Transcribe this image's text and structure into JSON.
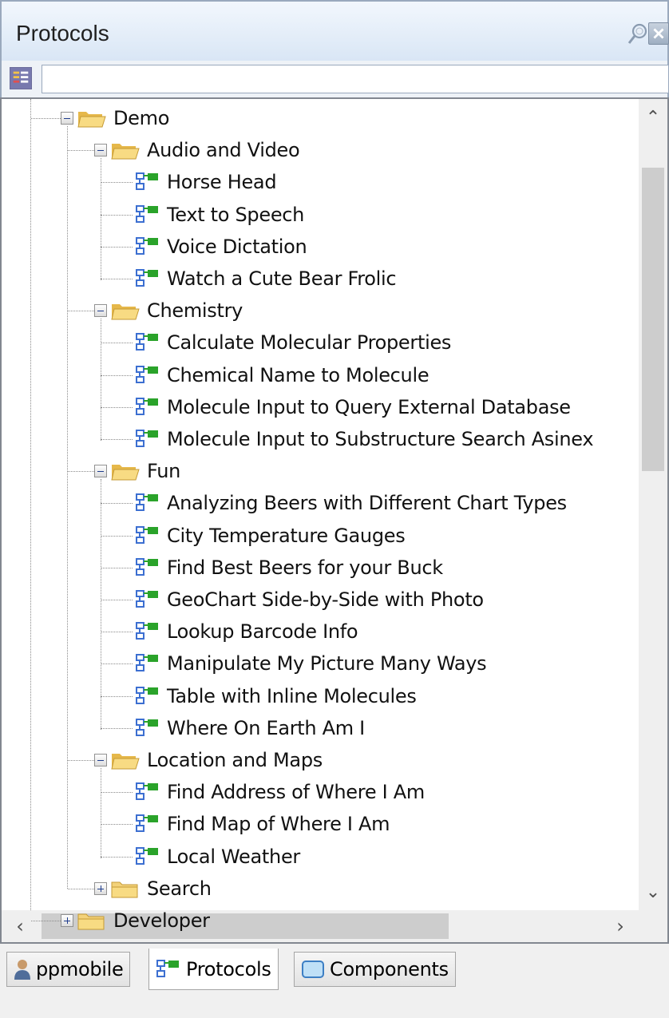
{
  "window": {
    "title": "Protocols",
    "pin_icon": "pushpin-icon",
    "close_icon": "close-icon"
  },
  "filter": {
    "icon": "filter-options-icon",
    "value": "",
    "placeholder": ""
  },
  "tree": {
    "root_open": {
      "label": "Demo",
      "icon": "folder-open-icon"
    },
    "groups": [
      {
        "label": "Audio and Video",
        "icon": "folder-open-icon",
        "items": [
          "Horse Head",
          "Text to Speech",
          "Voice Dictation",
          "Watch a Cute Bear Frolic"
        ]
      },
      {
        "label": "Chemistry",
        "icon": "folder-open-icon",
        "items": [
          "Calculate Molecular Properties",
          "Chemical Name to Molecule",
          "Molecule Input to Query External Database",
          "Molecule Input to Substructure Search Asinex"
        ]
      },
      {
        "label": "Fun",
        "icon": "folder-open-icon",
        "items": [
          "Analyzing Beers with Different Chart Types",
          "City Temperature Gauges",
          "Find Best Beers for your Buck",
          "GeoChart Side-by-Side with Photo",
          "Lookup Barcode Info",
          "Manipulate My Picture Many Ways",
          "Table with Inline Molecules",
          "Where On Earth Am I"
        ]
      },
      {
        "label": "Location and Maps",
        "icon": "folder-open-icon",
        "items": [
          "Find Address of Where I Am",
          "Find Map of Where I Am",
          "Local Weather"
        ]
      }
    ],
    "collapsed_group": {
      "label": "Search",
      "icon": "folder-closed-icon"
    },
    "collapsed_root": {
      "label": "Developer",
      "icon": "folder-closed-icon"
    },
    "protocol_icon": "protocol-icon"
  },
  "scrollbars": {
    "vertical_position": 0.1,
    "horizontal_position": 0.0
  },
  "tabs": [
    {
      "label": "ppmobile",
      "icon": "user-icon",
      "active": false
    },
    {
      "label": "Protocols",
      "icon": "protocol-icon",
      "active": true
    },
    {
      "label": "Components",
      "icon": "component-icon",
      "active": false
    }
  ],
  "colors": {
    "folder": "#f5d77a",
    "protocol_green": "#2aa32a",
    "protocol_blue": "#3c6fd1",
    "titlebar": "#dce8f6"
  }
}
